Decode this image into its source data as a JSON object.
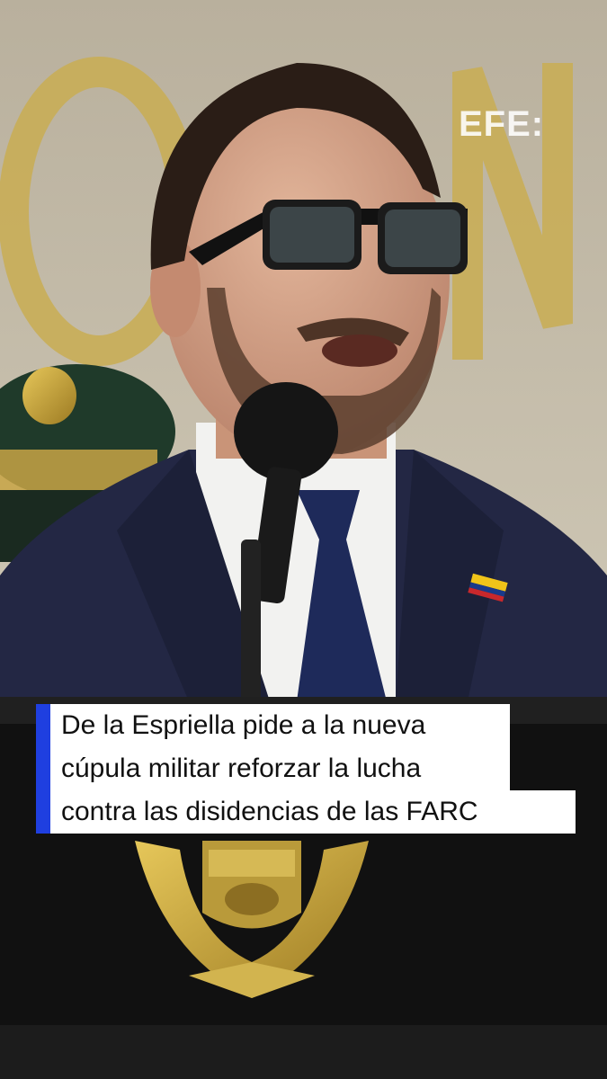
{
  "watermark": {
    "text": "EFE:"
  },
  "caption": {
    "lines": [
      "De la Espriella pide a la nueva",
      "cúpula militar reforzar la lucha",
      "contra las disidencias de las FARC"
    ],
    "accent_color": "#1f3fe0"
  },
  "colors": {
    "suit": "#232744",
    "podium": "#111111",
    "emblem": "#c9a53a",
    "background_wall": "#c8c0ae"
  }
}
